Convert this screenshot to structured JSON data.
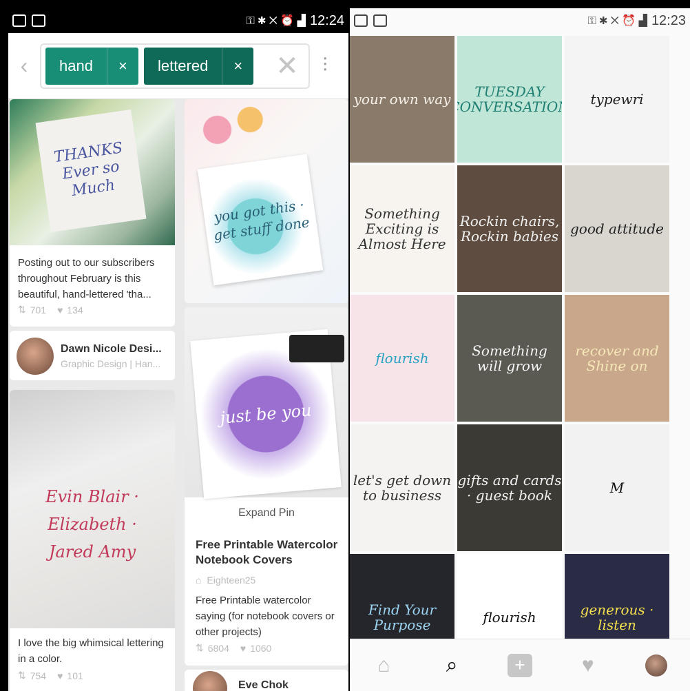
{
  "left_status": {
    "time": "12:24"
  },
  "right_status": {
    "time": "12:23"
  },
  "search": {
    "chips": [
      {
        "label": "hand",
        "remove": "×"
      },
      {
        "label": "lettered",
        "remove": "×"
      }
    ],
    "clear": "✕"
  },
  "pins": {
    "pin1": {
      "description": "Posting out to our subscribers throughout February is this beautiful, hand-lettered 'tha...",
      "repins": "701",
      "likes": "134",
      "artwork_text": "THANKS Ever so Much"
    },
    "user1": {
      "name": "Dawn Nicole Desi...",
      "subtitle": "Graphic Design | Han..."
    },
    "pin2": {
      "artwork_text": "you got this · get stuff done"
    },
    "pin3": {
      "artwork_text": "just be you",
      "expand": "Expand Pin"
    },
    "pin4": {
      "title": "Free Printable Watercolor Notebook Covers",
      "source": "Eighteen25",
      "description": "Free Printable watercolor saying (for notebook covers or other projects)",
      "repins": "6804",
      "likes": "1060"
    },
    "pin5": {
      "artwork_text": "Evin Blair · Elizabeth · Jared Amy",
      "description": "I love the big whimsical lettering in a color.",
      "repins": "754",
      "likes": "101"
    },
    "user2": {
      "name": "Eve Chok"
    }
  },
  "grid": [
    {
      "text": "your own way",
      "bg": "#8a7a6a",
      "color": "#f5f0e8"
    },
    {
      "text": "TUESDAY CONVERSATION",
      "bg": "#bfe6d6",
      "color": "#1f7f73"
    },
    {
      "text": "typewri",
      "bg": "#f4f4f4",
      "color": "#222"
    },
    {
      "text": "Something Exciting is Almost Here",
      "bg": "#f7f3ef",
      "color": "#333"
    },
    {
      "text": "Rockin chairs, Rockin babies",
      "bg": "#5d4c3f",
      "color": "#f0f0f0"
    },
    {
      "text": "good attitude",
      "bg": "#d9d6cf",
      "color": "#222"
    },
    {
      "text": "flourish",
      "bg": "#f6e4e8",
      "color": "#2aa1c4"
    },
    {
      "text": "Something will grow",
      "bg": "#5a5a52",
      "color": "#f6f6f6"
    },
    {
      "text": "recover and Shine on",
      "bg": "#c9a78a",
      "color": "#f6e7b8"
    },
    {
      "text": "let's get down to business",
      "bg": "#f5f3f1",
      "color": "#333"
    },
    {
      "text": "gifts and cards · guest book",
      "bg": "#3c3a35",
      "color": "#f0f0f0"
    },
    {
      "text": "M",
      "bg": "#f3f2f3",
      "color": "#111"
    },
    {
      "text": "Find Your Purpose",
      "bg": "#25262b",
      "color": "#9bd3f0"
    },
    {
      "text": "flourish",
      "bg": "#ffffff",
      "color": "#111"
    },
    {
      "text": "generous · listen",
      "bg": "#2a2c46",
      "color": "#f4e04d"
    }
  ],
  "nav": {
    "home": "⌂",
    "search": "⌕",
    "plus": "+",
    "heart": "♥"
  }
}
